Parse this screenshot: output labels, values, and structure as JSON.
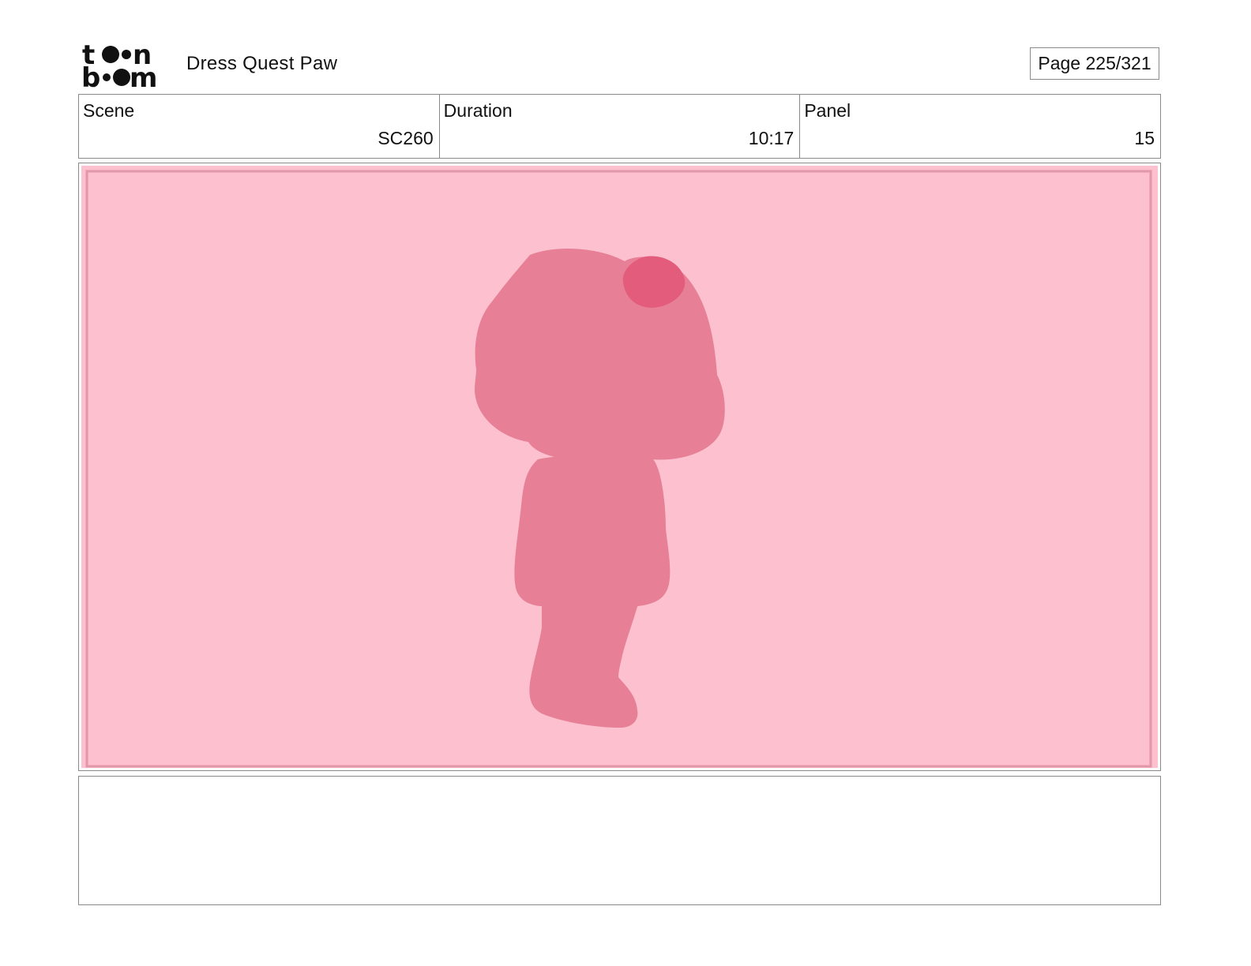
{
  "header": {
    "logo_text": "toon boom",
    "project_title": "Dress Quest Paw",
    "page_indicator": "Page 225/321"
  },
  "info": {
    "scene_label": "Scene",
    "scene_value": "SC260",
    "duration_label": "Duration",
    "duration_value": "10:17",
    "panel_label": "Panel",
    "panel_value": "15"
  },
  "panel": {
    "background_color": "#fdc0cf",
    "frame_color": "#f3a8ba",
    "silhouette_color": "#e77f96",
    "accent_color": "#e35c7c"
  },
  "notes": {
    "text": ""
  }
}
